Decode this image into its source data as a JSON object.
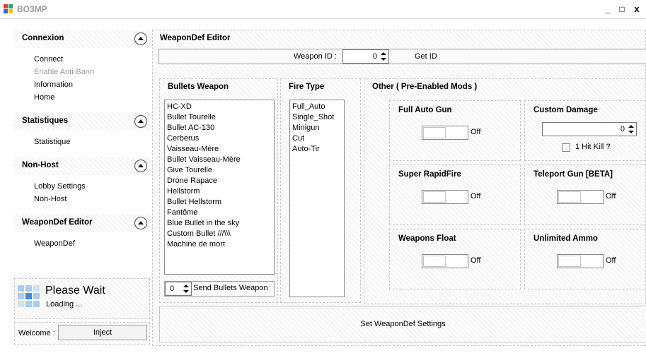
{
  "window": {
    "title": "BO3MP",
    "controls": [
      "_",
      "□",
      "x"
    ]
  },
  "colors": {
    "loader_blue": "#3a8fd8",
    "loader_light": "#a9cdee",
    "disabled_text": "#9a9a9a"
  },
  "sidebar": {
    "sections": [
      {
        "title": "Connexion",
        "items": [
          {
            "label": "Connect",
            "enabled": true
          },
          {
            "label": "Enable Anti-Bann",
            "enabled": false
          },
          {
            "label": "Information",
            "enabled": true
          },
          {
            "label": "Home",
            "enabled": true
          }
        ]
      },
      {
        "title": "Statistiques",
        "items": [
          {
            "label": "Statistique",
            "enabled": true
          }
        ]
      },
      {
        "title": "Non-Host",
        "items": [
          {
            "label": "Lobby Settings",
            "enabled": true
          },
          {
            "label": "Non-Host",
            "enabled": true
          }
        ]
      },
      {
        "title": "WeaponDef Editor",
        "items": [
          {
            "label": "WeaponDef",
            "enabled": true
          }
        ]
      }
    ]
  },
  "status": {
    "title": "Please Wait",
    "subtitle": "Loading ..."
  },
  "welcome": {
    "label": "Welcome :",
    "inject_label": "Inject"
  },
  "editor": {
    "title": "WeaponDef Editor",
    "weapon_id_label": "Weapon ID :",
    "weapon_id_value": "0",
    "get_id_label": "Get ID",
    "bullets": {
      "title": "Bullets Weapon",
      "items": [
        "HC-XD",
        "Bullet Tourelle",
        "Bullet AC-130",
        "Cerberus",
        "Vaisseau-Mère",
        "Bullet Vaisseau-Mère",
        "Give Tourelle",
        "Drone Rapace",
        "Hellstorm",
        "Bullet Hellstorm",
        "Fantôme",
        "Blue Bullet in the sky",
        "Custom Bullet ///\\\\\\",
        "Machine de mort"
      ],
      "send_value": "0",
      "send_label": "Send Bullets Weapon"
    },
    "fire": {
      "title": "Fire Type",
      "items": [
        "Full_Auto",
        "Single_Shot",
        "Minigun",
        "Cut",
        "Auto-Tir"
      ]
    },
    "other": {
      "title": "Other ( Pre-Enabled Mods )",
      "full_auto": {
        "title": "Full Auto Gun",
        "state": "Off"
      },
      "custom_damage": {
        "title": "Custom Damage",
        "value": "0",
        "hit_kill_label": "1 Hit Kill ?"
      },
      "super_rapid": {
        "title": "Super RapidFire",
        "state": "Off"
      },
      "teleport": {
        "title": "Teleport Gun [BETA]",
        "state": "Off"
      },
      "weapons_float": {
        "title": "Weapons Float",
        "state": "Off"
      },
      "unlimited_ammo": {
        "title": "Unlimited Ammo",
        "state": "Off"
      }
    },
    "set_button_label": "Set WeaponDef Settings"
  }
}
